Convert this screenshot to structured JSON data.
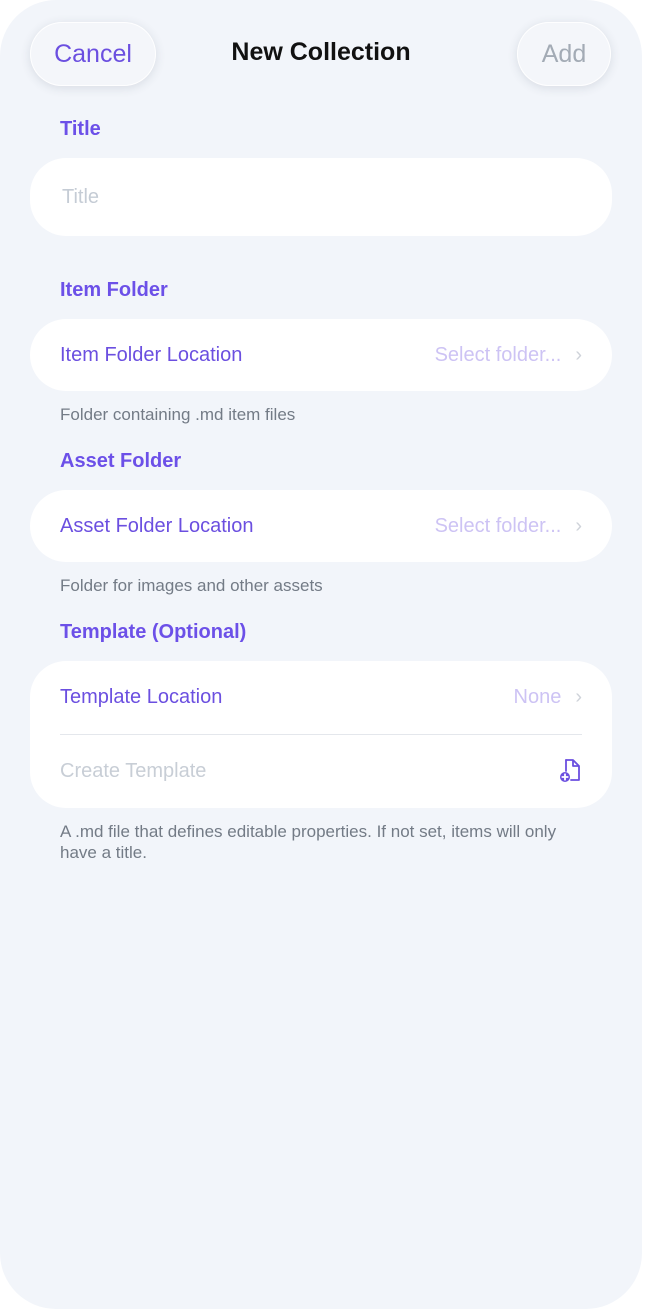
{
  "nav": {
    "cancel_label": "Cancel",
    "title": "New Collection",
    "add_label": "Add"
  },
  "title_section": {
    "header": "Title",
    "input_placeholder": "Title",
    "input_value": ""
  },
  "item_folder": {
    "header": "Item Folder",
    "row_label": "Item Folder Location",
    "row_value": "Select folder...",
    "footer": "Folder containing .md item files"
  },
  "asset_folder": {
    "header": "Asset Folder",
    "row_label": "Asset Folder Location",
    "row_value": "Select folder...",
    "footer": "Folder for images and other assets"
  },
  "template": {
    "header": "Template (Optional)",
    "location_label": "Template Location",
    "location_value": "None",
    "create_label": "Create Template",
    "create_icon": "document-plus-icon",
    "footer": "A .md file that defines editable properties. If not set, items will only have a title."
  },
  "colors": {
    "accent": "#6b4fe0",
    "background": "#f2f5fa",
    "card": "#ffffff"
  }
}
